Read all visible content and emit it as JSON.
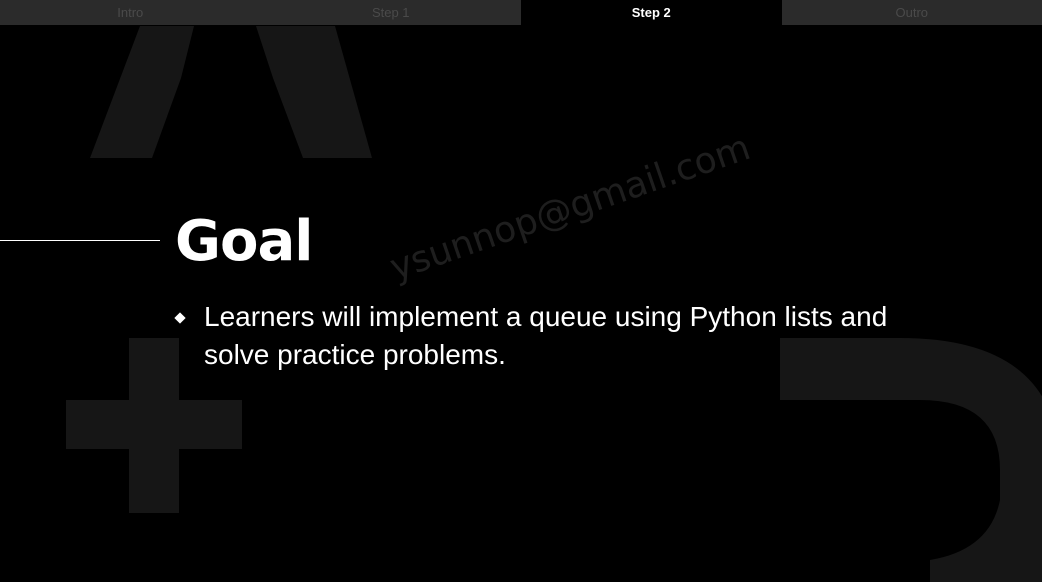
{
  "tabs": [
    {
      "label": "Intro",
      "active": false
    },
    {
      "label": "Step 1",
      "active": false
    },
    {
      "label": "Step 2",
      "active": true
    },
    {
      "label": "Outro",
      "active": false
    }
  ],
  "slide": {
    "title": "Goal",
    "bullets": [
      "Learners will implement a queue using Python lists and solve practice problems."
    ],
    "watermark": "ysunnop@gmail.com"
  },
  "colors": {
    "background": "#000000",
    "tab_inactive_bg": "#2b2b2b",
    "tab_inactive_text": "#4a4a4a",
    "tab_active_text": "#ffffff",
    "text": "#ffffff",
    "decoration": "#161616"
  },
  "decorations": [
    "caret-shape",
    "plus-shape",
    "d-shape"
  ]
}
